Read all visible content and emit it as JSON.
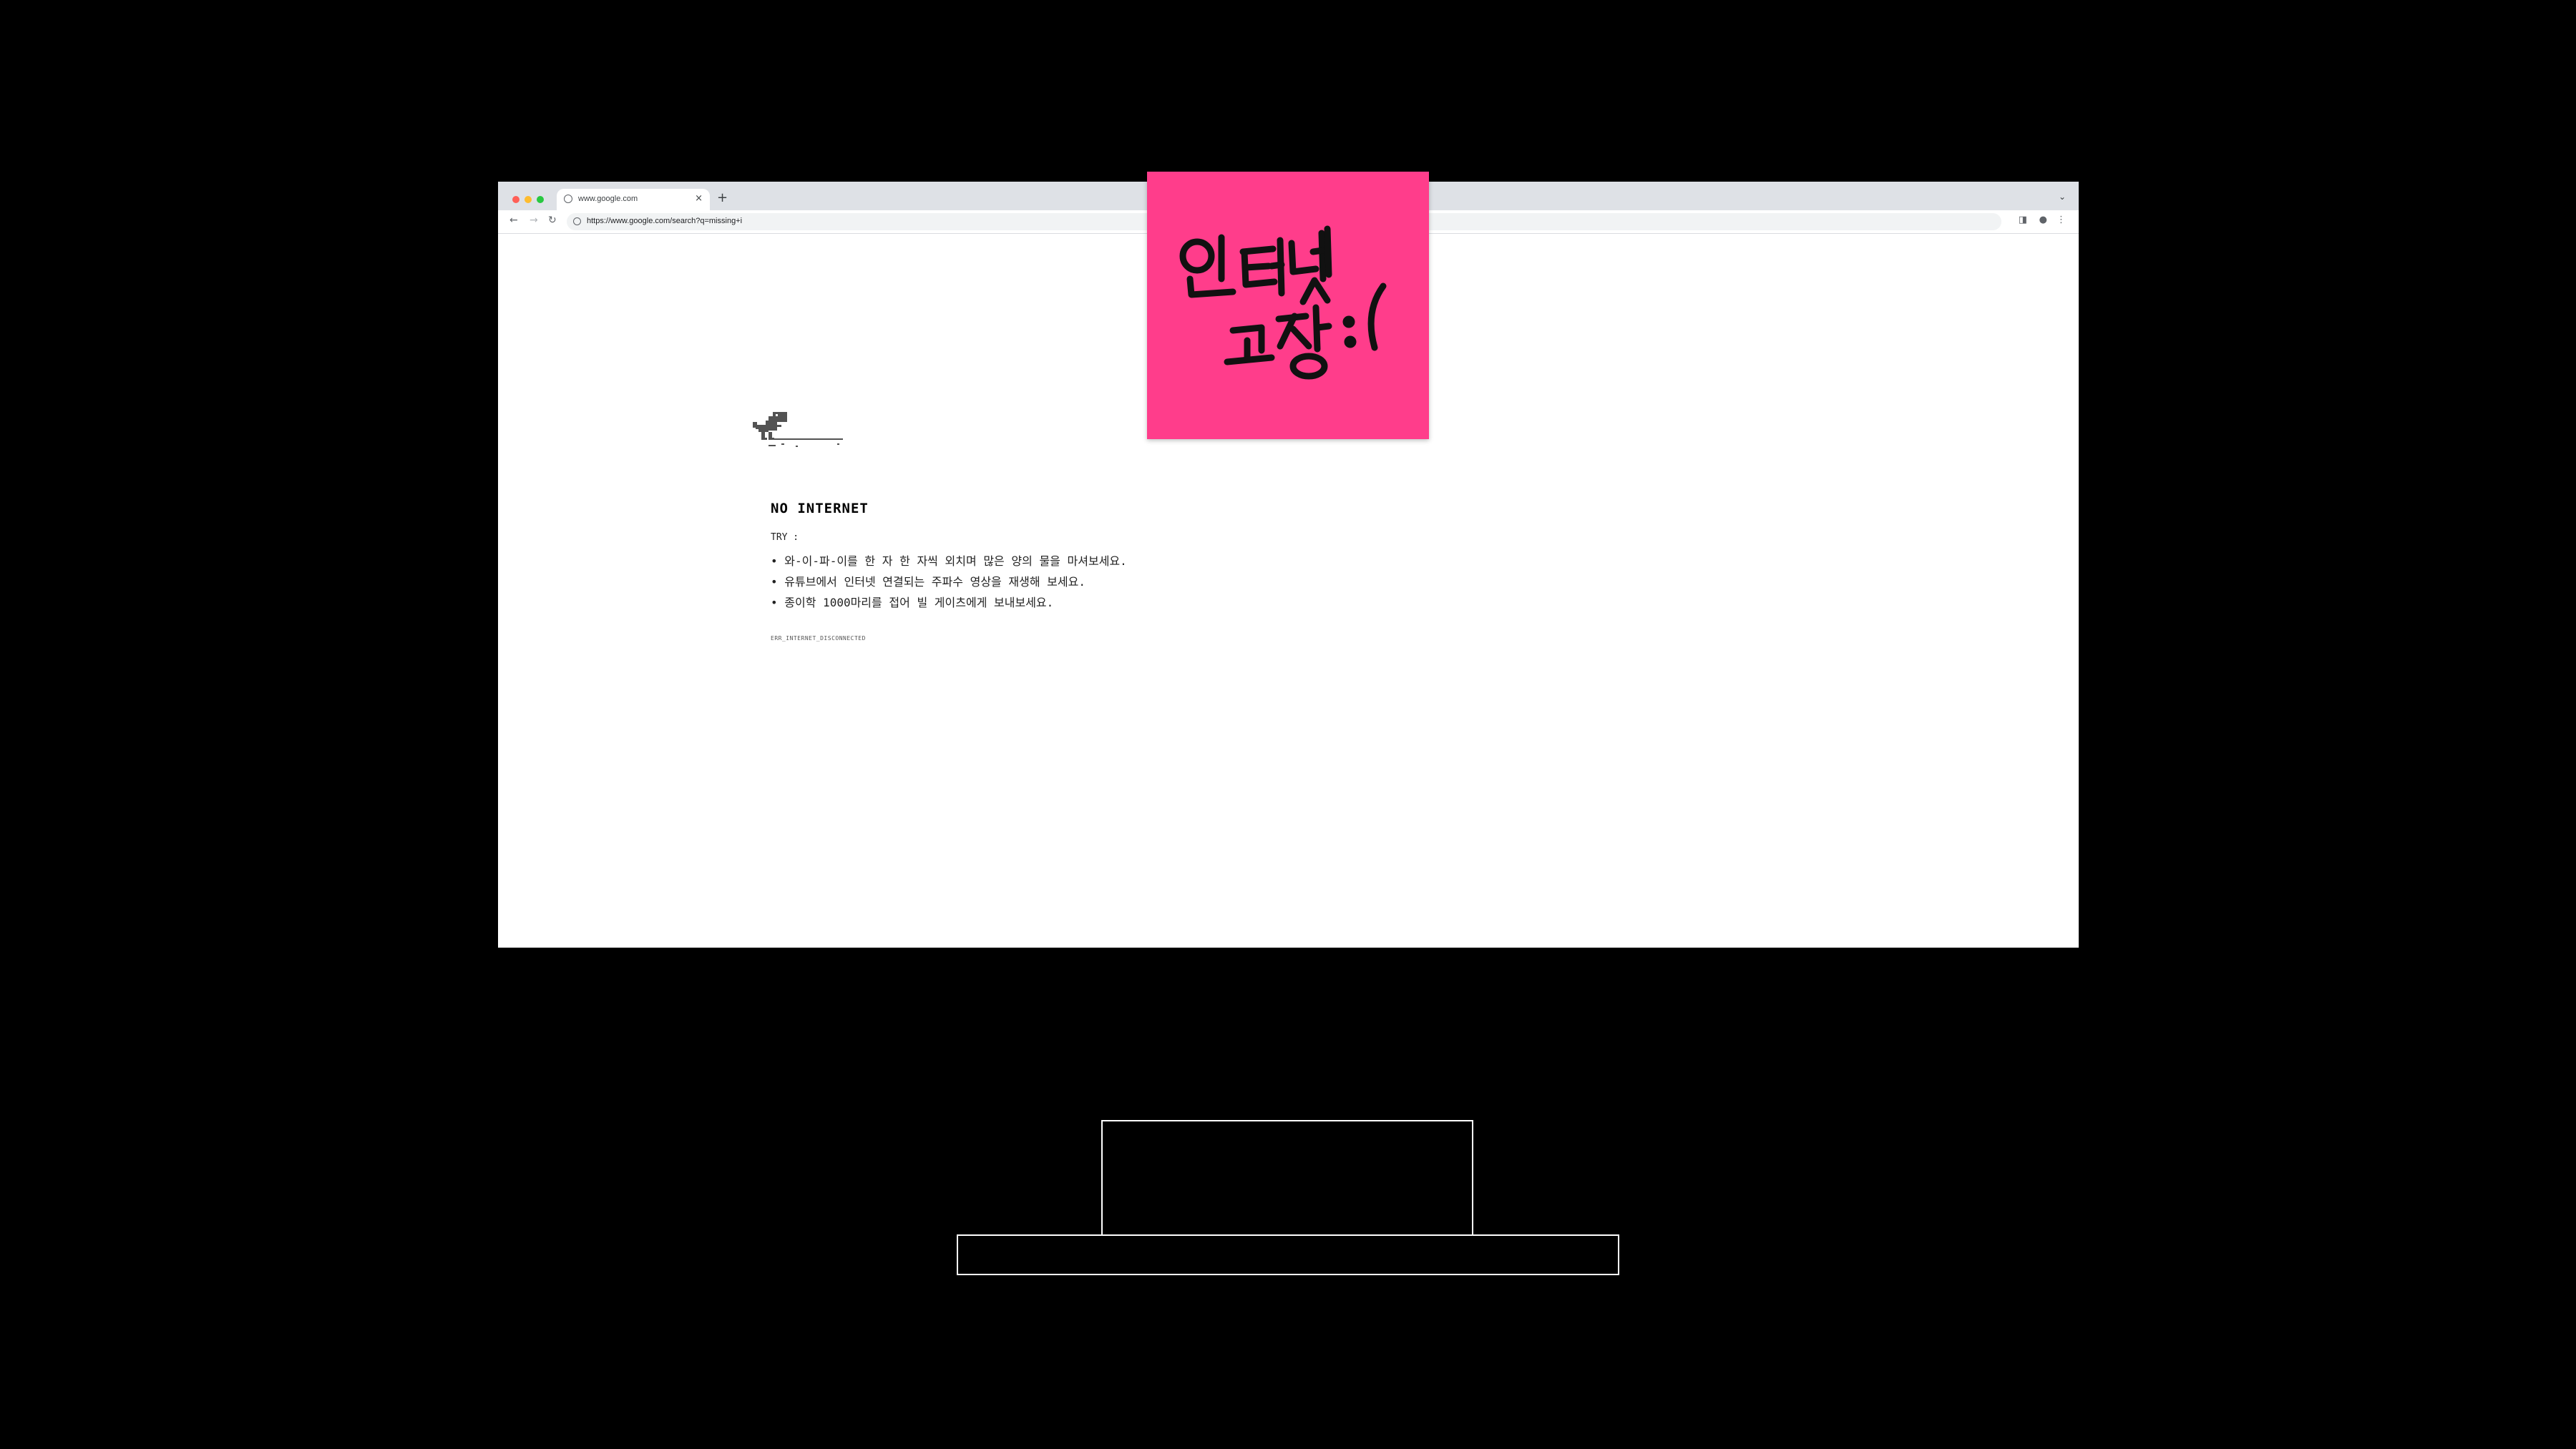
{
  "browser": {
    "tab_title": "www.google.com",
    "tab_close_icon": "close-icon",
    "new_tab_label": "+",
    "tab_dropdown_label": "⌄",
    "url": "https://www.google.com/search?q=missing+i"
  },
  "error_page": {
    "title": "NO INTERNET",
    "try_label": "TRY :",
    "suggestions": [
      "• 와-이-파-이를 한 자 한 자씩 외치며 많은 양의 물을 마셔보세요.",
      "• 유튜브에서 인터넷 연결되는 주파수 영상을 재생해 보세요.",
      "• 종이학 1000마리를 접어 빌 게이츠에게 보내보세요."
    ],
    "error_code": "ERR_INTERNET_DISCONNECTED"
  },
  "sticky_note": {
    "handwritten_text": "인터넷 고장 :(",
    "color": "#ff3d8b"
  },
  "colors": {
    "background": "#000000",
    "screen": "#ffffff",
    "tabstrip": "#dee1e6",
    "stand_outline": "#ffffff"
  }
}
